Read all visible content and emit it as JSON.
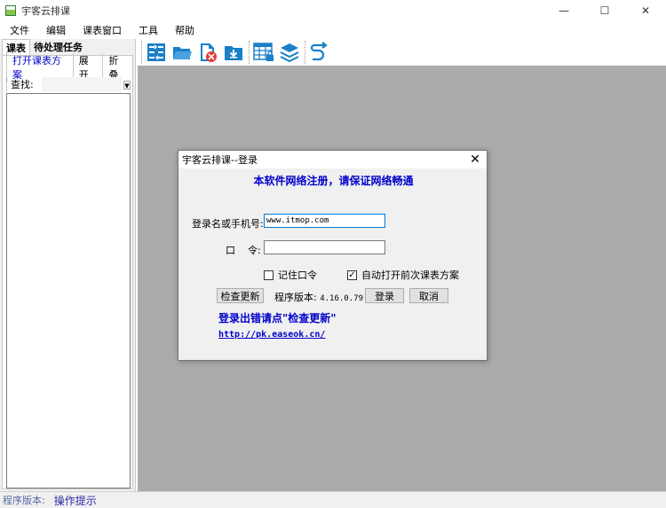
{
  "window": {
    "title": "宇客云排课",
    "minimize": "—",
    "maximize": "☐",
    "close": "✕"
  },
  "menu": [
    "文件",
    "编辑",
    "课表窗口",
    "工具",
    "帮助"
  ],
  "left_panel": {
    "tabs": [
      "课表",
      "待处理任务"
    ],
    "open_plan": "打开课表方案",
    "expand": "展开",
    "collapse": "折叠",
    "search_label": "查找:"
  },
  "toolbar": {
    "icons": [
      "grid-arrows-icon",
      "open-folder-icon",
      "delete-file-icon",
      "download-folder-icon",
      "locked-table-icon",
      "layers-icon",
      "redo-arrow-icon"
    ]
  },
  "statusbar": {
    "version_label": "程序版本:",
    "hint": "操作提示"
  },
  "dialog": {
    "title": "宇客云排课--登录",
    "close": "✕",
    "heading": "本软件网络注册，请保证网络畅通",
    "username_label": "登录名或手机号:",
    "username_value": "www.itmop.com",
    "password_label": "口    令:",
    "password_value": "",
    "remember_label": "记住口令",
    "remember_checked": false,
    "auto_open_label": "自动打开前次课表方案",
    "auto_open_checked": true,
    "check_update": "检查更新",
    "version_label": "程序版本:",
    "version_value": "4.16.0.79",
    "login": "登录",
    "cancel": "取消",
    "error_tip": "登录出错请点\"检查更新\"",
    "link": "http://pk.easeok.cn/"
  },
  "colors": {
    "accent_blue": "#0000cc",
    "mdi_background": "#ababab",
    "icon_blue": "#1a7fc8"
  }
}
